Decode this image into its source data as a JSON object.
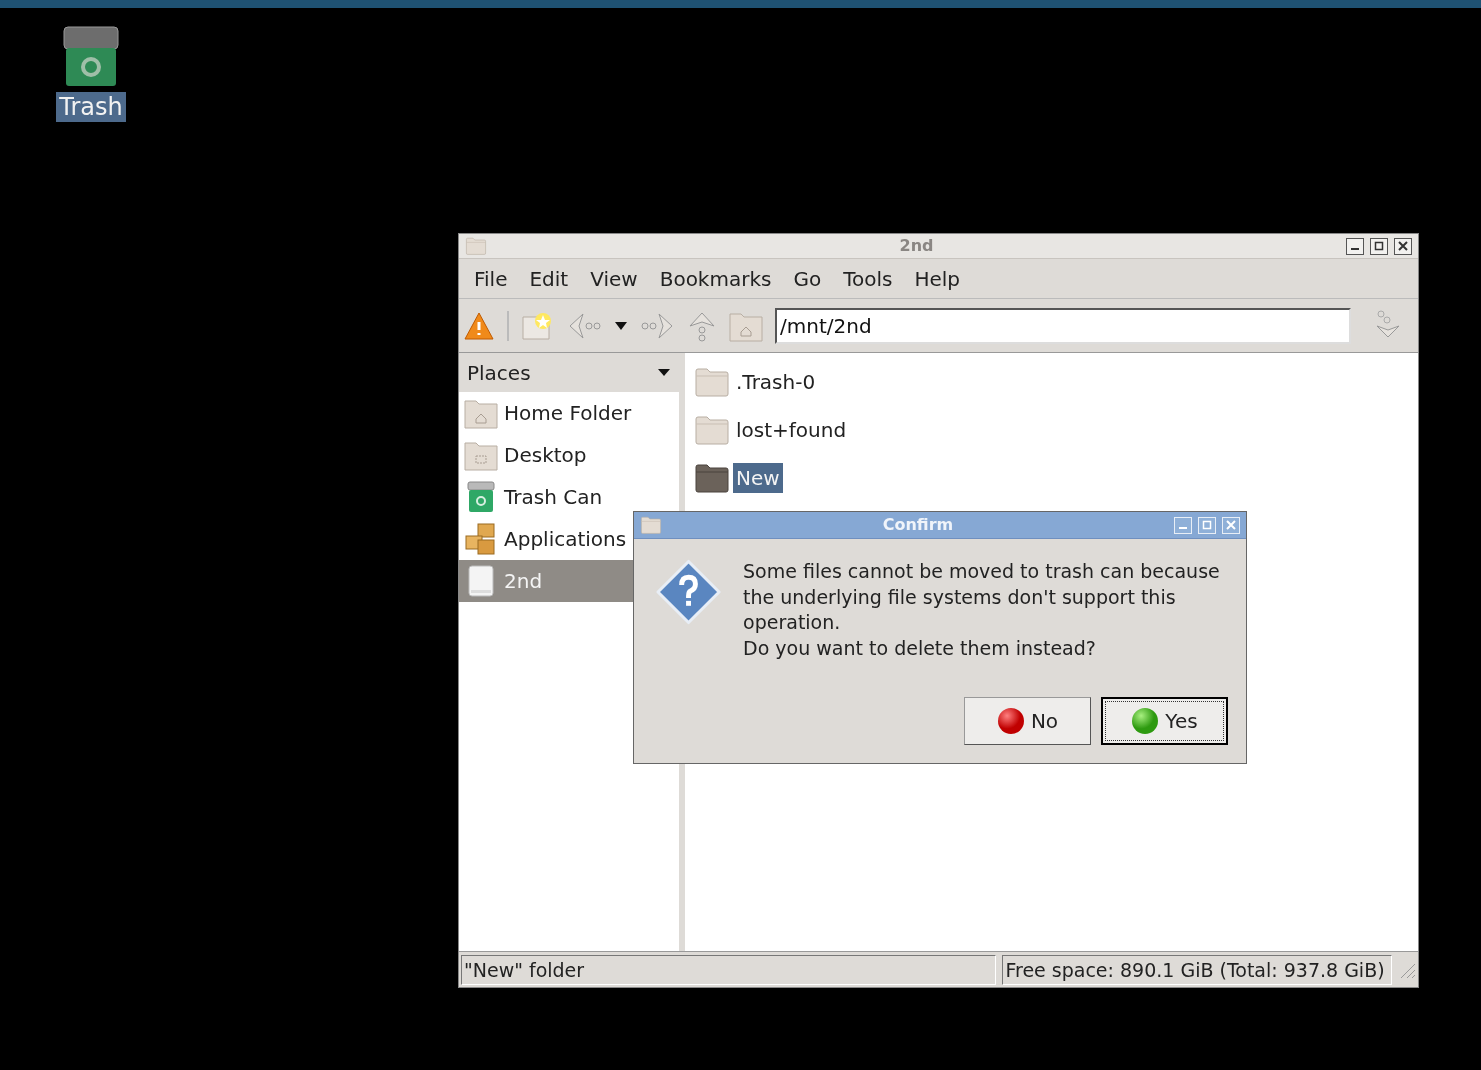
{
  "desktop_icons": [
    {
      "label": "Trash",
      "selected": true
    }
  ],
  "file_manager": {
    "title": "2nd",
    "menu": [
      "File",
      "Edit",
      "View",
      "Bookmarks",
      "Go",
      "Tools",
      "Help"
    ],
    "location": "/mnt/2nd",
    "places": {
      "header": "Places",
      "items": [
        {
          "label": "Home Folder",
          "kind": "home",
          "selected": false
        },
        {
          "label": "Desktop",
          "kind": "desktop",
          "selected": false
        },
        {
          "label": "Trash Can",
          "kind": "trash",
          "selected": false
        },
        {
          "label": "Applications",
          "kind": "applications",
          "selected": false
        },
        {
          "label": "2nd",
          "kind": "drive",
          "selected": true
        }
      ]
    },
    "files": [
      {
        "name": ".Trash-0",
        "selected": false
      },
      {
        "name": "lost+found",
        "selected": false
      },
      {
        "name": "New",
        "selected": true
      }
    ],
    "status_bar": {
      "selection": "\"New\" folder",
      "free_space": "Free space: 890.1 GiB (Total: 937.8 GiB)"
    }
  },
  "dialog": {
    "title": "Confirm",
    "message": [
      "Some files cannot be moved to trash can because the underlying file systems don't support this operation.",
      "Do you want to delete them instead?"
    ],
    "buttons": [
      {
        "label": "No",
        "kind": "no",
        "default": false
      },
      {
        "label": "Yes",
        "kind": "yes",
        "default": true
      }
    ]
  }
}
